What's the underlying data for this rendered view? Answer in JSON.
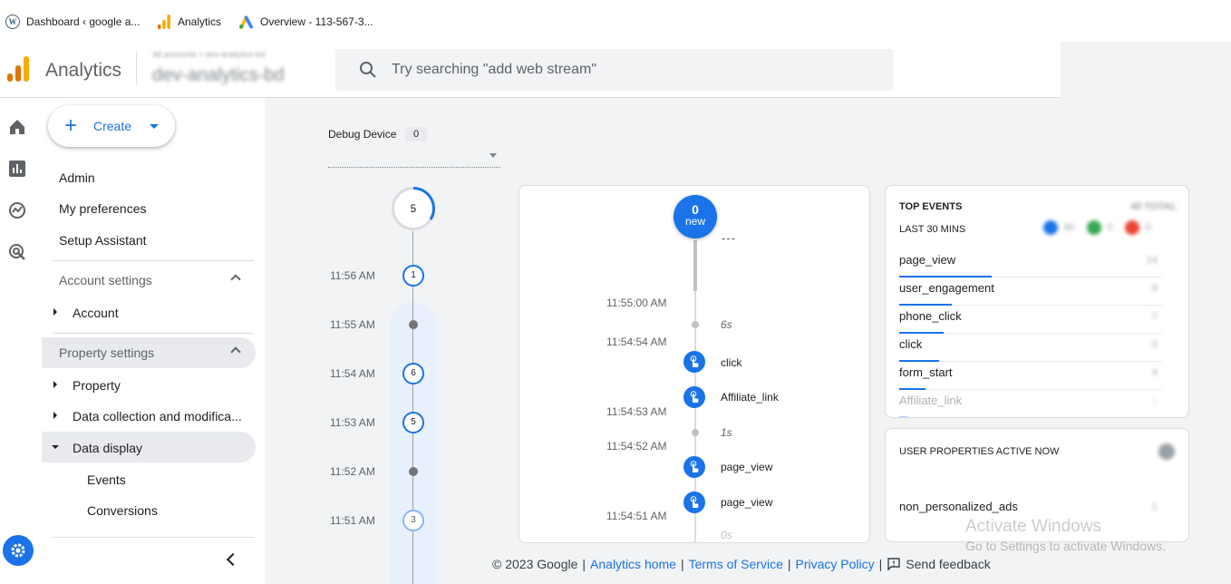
{
  "bookmarks": [
    {
      "label": "Dashboard ‹ google a...",
      "icon": "wordpress-icon"
    },
    {
      "label": "Analytics",
      "icon": "analytics-icon"
    },
    {
      "label": "Overview - 113-567-3...",
      "icon": "google-ads-icon"
    }
  ],
  "header": {
    "app_name": "Analytics",
    "account_path": "All accounts > dev-analytics-bd",
    "property_name": "dev-analytics-bd",
    "search_placeholder": "Try searching \"add web stream\""
  },
  "nav": {
    "create_label": "Create",
    "items": [
      "Admin",
      "My preferences",
      "Setup Assistant"
    ],
    "account_settings": "Account settings",
    "account": "Account",
    "property_settings": "Property settings",
    "property": "Property",
    "data_collection": "Data collection and modifica...",
    "data_display": "Data display",
    "events": "Events",
    "conversions": "Conversions"
  },
  "debug": {
    "label": "Debug Device",
    "count": "0"
  },
  "minutes": {
    "top_count": "5",
    "times": [
      "11:56 AM",
      "11:55 AM",
      "11:54 AM",
      "11:53 AM",
      "11:52 AM",
      "11:51 AM"
    ],
    "counts": [
      "1",
      "",
      "6",
      "5",
      "",
      "3"
    ]
  },
  "stream": {
    "badge_count": "0",
    "badge_word": "new",
    "dashes": "---",
    "times": [
      "11:55:00 AM",
      "11:54:54 AM",
      "11:54:53 AM",
      "11:54:52 AM",
      "11:54:51 AM"
    ],
    "durations": [
      "6s",
      "1s",
      "0s"
    ],
    "events": [
      "click",
      "Affiliate_link",
      "page_view",
      "page_view"
    ]
  },
  "top_events": {
    "title": "TOP EVENTS",
    "total_label": "40 TOTAL",
    "period": "LAST 30 MINS",
    "legend": [
      {
        "count": "40",
        "color": "#1a73e8"
      },
      {
        "count": "0",
        "color": "#34a853"
      },
      {
        "count": "0",
        "color": "#ea4335"
      }
    ],
    "rows": [
      {
        "name": "page_view",
        "count": "14",
        "bar": 0.35
      },
      {
        "name": "user_engagement",
        "count": "8",
        "bar": 0.2
      },
      {
        "name": "phone_click",
        "count": "7",
        "bar": 0.17
      },
      {
        "name": "click",
        "count": "6",
        "bar": 0.15
      },
      {
        "name": "form_start",
        "count": "4",
        "bar": 0.1
      },
      {
        "name": "Affiliate_link",
        "count": "1",
        "bar": 0.03
      }
    ]
  },
  "user_props": {
    "title": "USER PROPERTIES ACTIVE NOW",
    "rows": [
      {
        "name": "non_personalized_ads",
        "count": "1"
      }
    ]
  },
  "footer": {
    "copyright": "© 2023 Google",
    "links": [
      "Analytics home",
      "Terms of Service",
      "Privacy Policy"
    ],
    "feedback": "Send feedback"
  },
  "watermark": {
    "line1": "Activate Windows",
    "line2": "Go to Settings to activate Windows."
  }
}
